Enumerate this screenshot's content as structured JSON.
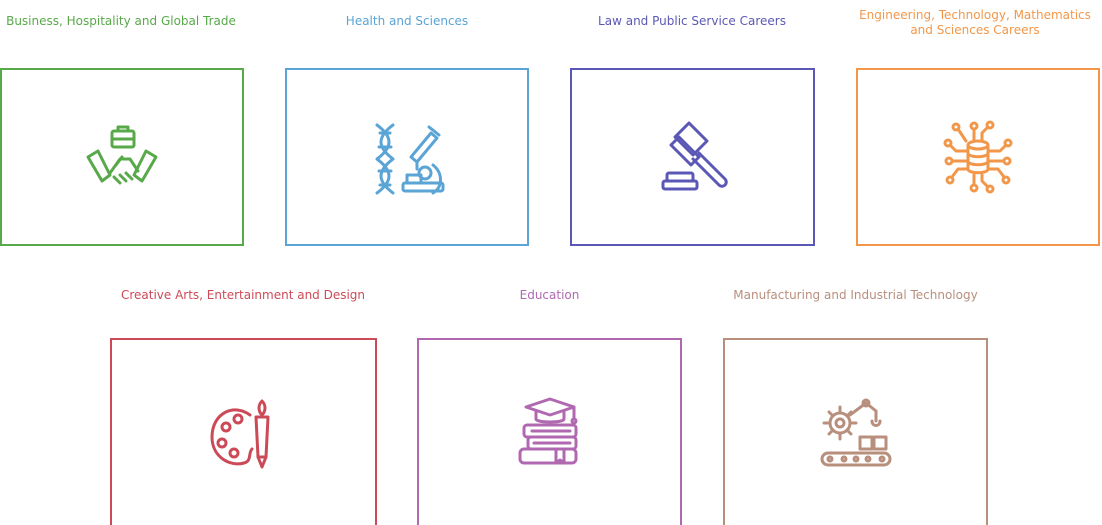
{
  "categories": [
    {
      "title": "Business, Hospitality and Global Trade",
      "color": "#58a94a",
      "icon": "handshake-briefcase-icon"
    },
    {
      "title": "Health and Sciences",
      "color": "#5aa4d6",
      "icon": "dna-microscope-icon"
    },
    {
      "title": "Law and Public Service Careers",
      "color": "#5b58b5",
      "icon": "gavel-icon"
    },
    {
      "title": "Engineering, Technology, Mathematics and Sciences Careers",
      "color": "#f2974a",
      "icon": "circuit-database-icon"
    },
    {
      "title": "Creative Arts, Entertainment and Design",
      "color": "#cc4a57",
      "icon": "palette-brush-icon"
    },
    {
      "title": "Education",
      "color": "#b069b1",
      "icon": "books-graduation-cap-icon"
    },
    {
      "title": "Manufacturing and Industrial Technology",
      "color": "#b88f7d",
      "icon": "robot-arm-conveyor-icon"
    }
  ]
}
